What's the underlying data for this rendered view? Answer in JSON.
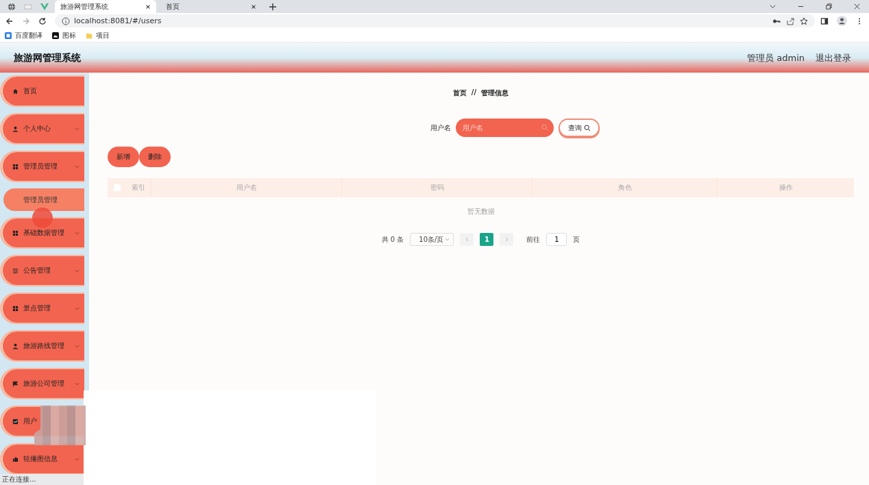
{
  "browser": {
    "tabs": [
      {
        "title": "旅游网管理系统",
        "selected": true
      },
      {
        "title": "首页",
        "selected": false
      }
    ],
    "url": "localhost:8081/#/users",
    "bookmarks": [
      "百度翻译",
      "图标",
      "项目"
    ]
  },
  "header": {
    "title": "旅游网管理系统",
    "user": "管理员 admin",
    "logout": "退出登录"
  },
  "sidebar": {
    "items": [
      {
        "label": "首页",
        "kind": "home",
        "collapsible": false
      },
      {
        "label": "个人中心",
        "kind": "user",
        "collapsible": true
      },
      {
        "label": "管理员管理",
        "kind": "grid",
        "collapsible": true,
        "children": [
          {
            "label": "管理员管理"
          }
        ]
      },
      {
        "label": "基础数据管理",
        "kind": "grid",
        "collapsible": true
      },
      {
        "label": "公告管理",
        "kind": "sliders",
        "collapsible": true
      },
      {
        "label": "景点管理",
        "kind": "grid",
        "collapsible": true
      },
      {
        "label": "旅游路线管理",
        "kind": "user",
        "collapsible": true
      },
      {
        "label": "旅游公司管理",
        "kind": "flag",
        "collapsible": true
      },
      {
        "label": "用户",
        "kind": "chart"
      },
      {
        "label": "轮播图信息",
        "kind": "thumb",
        "collapsible": true
      }
    ]
  },
  "breadcrumb": {
    "items": [
      "首页",
      "管理信息"
    ],
    "separator": "//"
  },
  "search": {
    "label": "用户名",
    "placeholder": "用户名",
    "button": "查询"
  },
  "actions": [
    "新增",
    "删除"
  ],
  "table": {
    "select_all_checked": false,
    "columns": [
      "索引",
      "用户名",
      "密码",
      "角色",
      "操作"
    ],
    "empty": "暂无数据"
  },
  "pagination": {
    "total": "共 0 条",
    "page_size": "10条/页",
    "pages": [
      {
        "label": "1",
        "selected": true
      }
    ],
    "goto_label": "前往",
    "goto_value": "1",
    "goto_suffix": "页"
  },
  "status_bar": "正在连接..."
}
